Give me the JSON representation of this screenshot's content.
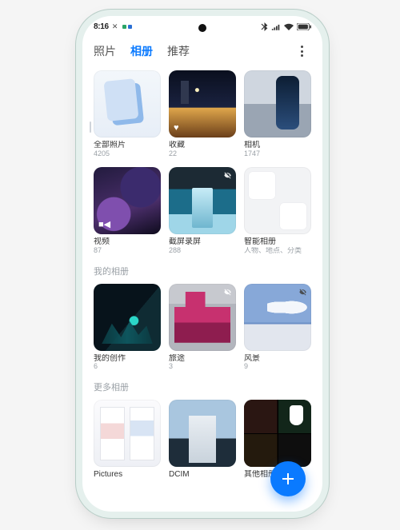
{
  "status": {
    "time": "8:16",
    "icons": [
      "no-sim-icon",
      "square-a",
      "square-b"
    ]
  },
  "tabs": {
    "items": [
      "照片",
      "相册",
      "推荐"
    ],
    "activeIndex": 1
  },
  "sections": [
    {
      "title": null,
      "items": [
        {
          "key": "all",
          "label": "全部照片",
          "count": "4205",
          "thumb": "t-allphotos"
        },
        {
          "key": "fav",
          "label": "收藏",
          "count": "22",
          "thumb": "t-fav",
          "badge": "heart"
        },
        {
          "key": "cam",
          "label": "相机",
          "count": "1747",
          "thumb": "t-cam"
        },
        {
          "key": "vid",
          "label": "视频",
          "count": "87",
          "thumb": "t-video",
          "badge": "video"
        },
        {
          "key": "shot",
          "label": "截屏录屏",
          "count": "288",
          "thumb": "t-shot",
          "badge": "hide"
        },
        {
          "key": "smart",
          "label": "智能相册",
          "count": "人物、地点、分类",
          "thumb": "t-smart"
        }
      ]
    },
    {
      "title": "我的相册",
      "items": [
        {
          "key": "create",
          "label": "我的创作",
          "count": "6",
          "thumb": "t-create"
        },
        {
          "key": "trip",
          "label": "旅途",
          "count": "3",
          "thumb": "t-trip",
          "badge": "hide"
        },
        {
          "key": "land",
          "label": "风景",
          "count": "9",
          "thumb": "t-land",
          "badge": "hide"
        }
      ]
    },
    {
      "title": "更多相册",
      "items": [
        {
          "key": "pictures",
          "label": "Pictures",
          "count": "",
          "thumb": "t-pics"
        },
        {
          "key": "dcim",
          "label": "DCIM",
          "count": "",
          "thumb": "t-dcim"
        },
        {
          "key": "other",
          "label": "其他相册",
          "count": "",
          "thumb": "t-other"
        }
      ]
    }
  ],
  "fab": {
    "label": "add"
  }
}
